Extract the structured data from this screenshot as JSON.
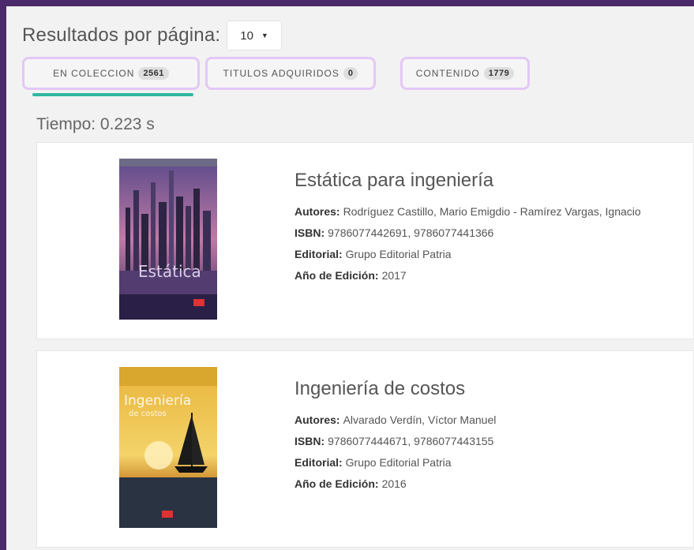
{
  "pagination": {
    "label": "Resultados por página:",
    "per_page_value": "10"
  },
  "tabs": [
    {
      "label": "EN COLECCION",
      "count": "2561"
    },
    {
      "label": "TITULOS ADQUIRIDOS",
      "count": "0"
    },
    {
      "label": "CONTENIDO",
      "count": "1779"
    }
  ],
  "time_label": "Tiempo: 0.223 s",
  "field_labels": {
    "authors": "Autores:",
    "isbn": "ISBN:",
    "publisher": "Editorial:",
    "year": "Año de Edición:"
  },
  "results": [
    {
      "title": "Estática para ingeniería",
      "authors": "Rodríguez Castillo, Mario Emigdio - Ramírez Vargas, Ignacio",
      "isbn": "9786077442691, 9786077441366",
      "publisher": "Grupo Editorial Patria",
      "year": "2017",
      "cover_text": "Estática"
    },
    {
      "title": "Ingeniería de costos",
      "authors": "Alvarado Verdín, Víctor Manuel",
      "isbn": "9786077444671, 9786077443155",
      "publisher": "Grupo Editorial Patria",
      "year": "2016",
      "cover_text": "Ingeniería",
      "cover_subtext": "de costos"
    }
  ],
  "colors": {
    "accent": "#2fb8a0",
    "highlight_border": "#e3c8f6",
    "frame": "#4b2a6b"
  }
}
